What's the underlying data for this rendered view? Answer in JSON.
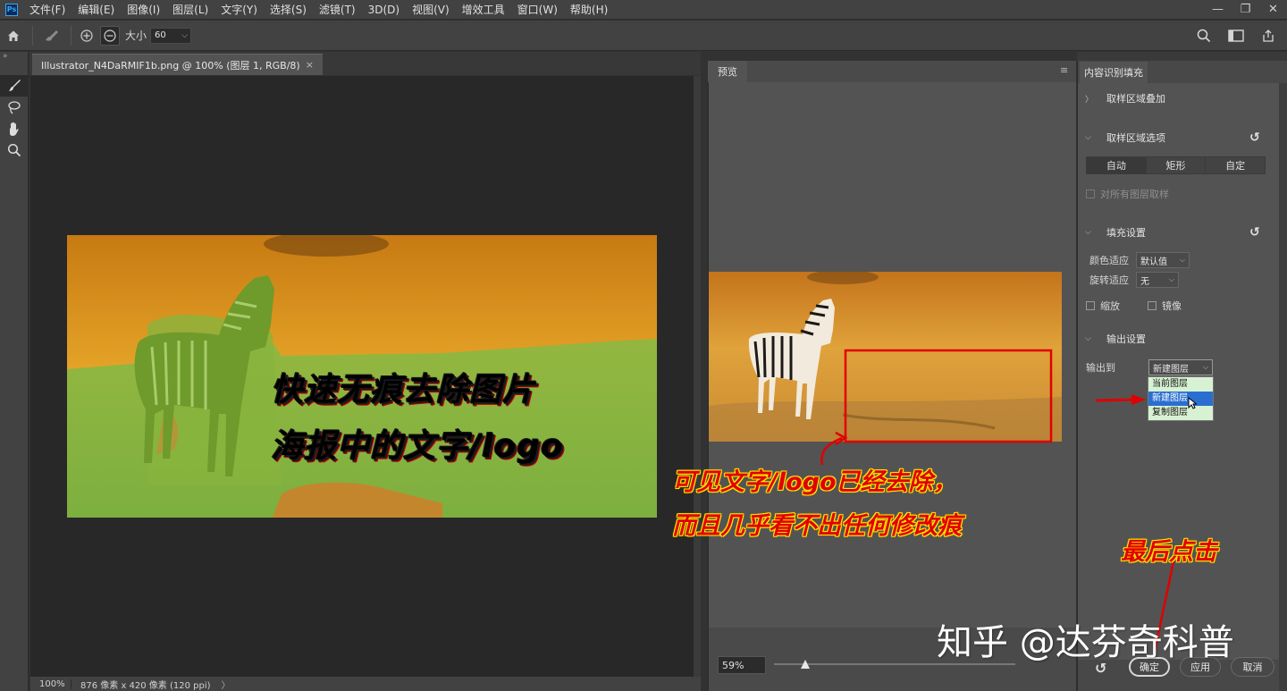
{
  "app": {
    "logo": "Ps"
  },
  "menu": [
    "文件(F)",
    "编辑(E)",
    "图像(I)",
    "图层(L)",
    "文字(Y)",
    "选择(S)",
    "滤镜(T)",
    "3D(D)",
    "视图(V)",
    "增效工具",
    "窗口(W)",
    "帮助(H)"
  ],
  "window_controls": {
    "minimize": "—",
    "restore": "❐",
    "close": "✕"
  },
  "options_bar": {
    "size_label": "大小",
    "size_value": "60"
  },
  "document": {
    "tab_title": "Illustrator_N4DaRMIF1b.png @ 100% (图层 1, RGB/8)",
    "tab_close": "×",
    "zoom": "100%",
    "info": "876 像素 x 420 像素 (120 ppi)",
    "info_arrow": "〉",
    "overlay_line1": "快速无痕去除图片",
    "overlay_line2": "海报中的文字/logo"
  },
  "preview": {
    "tab_label": "预览",
    "zoom_value": "59%",
    "zoom_slider_fraction": 0.13
  },
  "panel": {
    "tab_label": "内容识别填充",
    "sampling_overlay": "取样区域叠加",
    "sampling_options": "取样区域选项",
    "sampling_modes": [
      "自动",
      "矩形",
      "自定"
    ],
    "sample_all_layers": "对所有图层取样",
    "fill_settings": "填充设置",
    "color_adapt_label": "颜色适应",
    "color_adapt_value": "默认值",
    "rotation_adapt_label": "旋转适应",
    "rotation_adapt_value": "无",
    "scale_label": "缩放",
    "mirror_label": "镜像",
    "output_settings": "输出设置",
    "output_to_label": "输出到",
    "output_to_value": "新建图层",
    "output_options": [
      "当前图层",
      "新建图层",
      "复制图层"
    ]
  },
  "footer": {
    "ok": "确定",
    "apply": "应用",
    "cancel": "取消"
  },
  "annotations": {
    "note_line1": "可见文字/logo已经去除，",
    "note_line2": "而且几乎看不出任何修改痕",
    "click_hint": "最后点击",
    "watermark": "知乎 @达芬奇科普"
  },
  "colors": {
    "annotation_red": "#e00000",
    "annotation_yellow": "#fff200",
    "highlight_blue": "#2a6fd0"
  }
}
